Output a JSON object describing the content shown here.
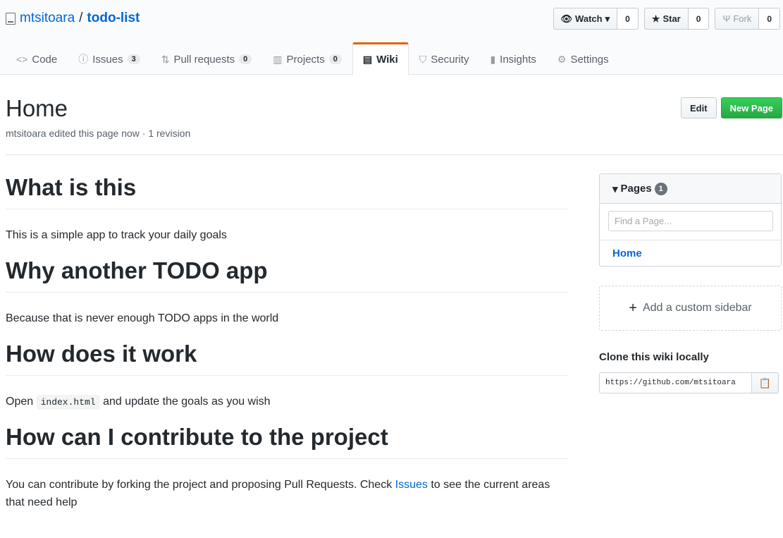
{
  "repo": {
    "owner": "mtsitoara",
    "separator": "/",
    "name": "todo-list",
    "watch_label": "Watch",
    "watch_count": "0",
    "star_label": "Star",
    "star_count": "0",
    "fork_label": "Fork",
    "fork_count": "0"
  },
  "tabs": [
    {
      "label": "Code",
      "icon": "code-icon"
    },
    {
      "label": "Issues",
      "count": "3",
      "icon": "issue-icon"
    },
    {
      "label": "Pull requests",
      "count": "0",
      "icon": "pull-request-icon"
    },
    {
      "label": "Projects",
      "count": "0",
      "icon": "project-icon"
    },
    {
      "label": "Wiki",
      "icon": "book-icon",
      "selected": true
    },
    {
      "label": "Security",
      "icon": "shield-icon"
    },
    {
      "label": "Insights",
      "icon": "graph-icon"
    },
    {
      "label": "Settings",
      "icon": "gear-icon"
    }
  ],
  "page": {
    "title": "Home",
    "meta": "mtsitoara edited this page now · 1 revision",
    "edit_label": "Edit",
    "new_page_label": "New Page"
  },
  "content": {
    "h1": "What is this",
    "p1": "This is a simple app to track your daily goals",
    "h2": "Why another TODO app",
    "p2": "Because that is never enough TODO apps in the world",
    "h3": "How does it work",
    "p3_before": "Open",
    "p3_code": "index.html",
    "p3_after": "and update the goals as you wish",
    "h4": "How can I contribute to the project",
    "p4_before": "You can contribute by forking the project and proposing Pull Requests. Check",
    "p4_link": "Issues",
    "p4_after": "to see the current areas that need help"
  },
  "sidebar": {
    "pages_label": "Pages",
    "pages_count": "1",
    "filter_placeholder": "Find a Page...",
    "page_link": "Home",
    "custom_sidebar_label": "Add a custom sidebar",
    "clone_title": "Clone this wiki locally",
    "clone_url": "https://github.com/mtsitoara"
  },
  "colors": {
    "link": "#0366d6",
    "tab_accent": "#e36209",
    "new_page_green": "#28a745"
  }
}
